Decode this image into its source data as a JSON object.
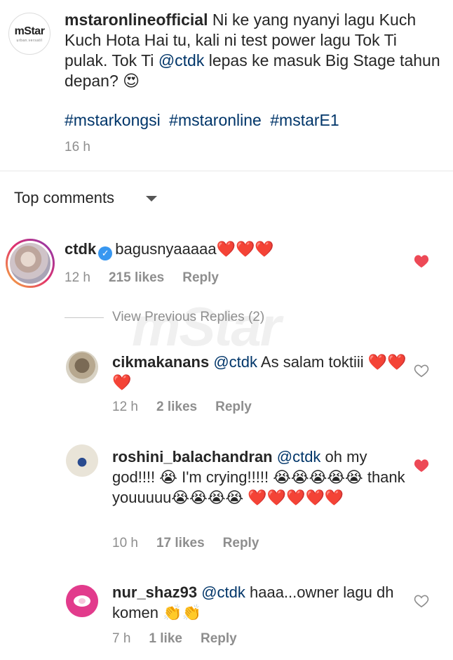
{
  "caption": {
    "logo_text": "mStar",
    "logo_tagline": "urban.versatil",
    "username": "mstaronlineofficial",
    "text_before_mention": "Ni ke yang nyanyi lagu Kuch Kuch Hota Hai tu, kali ni test power lagu Tok Ti pulak. Tok Ti ",
    "mention": "@ctdk",
    "text_after_mention": " lepas ke masuk Big Stage tahun depan? 😍",
    "hashtags": [
      "#mstarkongsi",
      "#mstaronline",
      "#mstarE1"
    ],
    "time": "16 h"
  },
  "sort": {
    "label": "Top comments"
  },
  "watermark": "mStar",
  "comments": [
    {
      "username": "ctdk",
      "verified": true,
      "text": "bagusnyaaaaa❤️❤️❤️",
      "time": "12 h",
      "likes": "215 likes",
      "reply": "Reply",
      "liked": true
    }
  ],
  "view_previous": "View Previous Replies (2)",
  "replies": [
    {
      "username": "cikmakanans",
      "mention": "@ctdk",
      "text": " As salam toktiii ❤️❤️❤️",
      "time": "12 h",
      "likes": "2 likes",
      "reply": "Reply",
      "liked": false
    },
    {
      "username": "roshini_balachandran",
      "mention": "@ctdk",
      "text": " oh my god!!!! 😭 I'm crying!!!!! 😭😭😭😭😭 thank youuuuu😭😭😭😭 ❤️❤️❤️❤️❤️",
      "time": "10 h",
      "likes": "17 likes",
      "reply": "Reply",
      "liked": true
    },
    {
      "username": "nur_shaz93",
      "mention": "@ctdk",
      "text": " haaa...owner lagu dh komen 👏👏",
      "time": "7 h",
      "likes": "1 like",
      "reply": "Reply",
      "liked": false
    }
  ],
  "colors": {
    "like_red": "#ed4956",
    "link_blue": "#003569",
    "meta_gray": "#8e8e8e",
    "verified_blue": "#3897f0"
  }
}
